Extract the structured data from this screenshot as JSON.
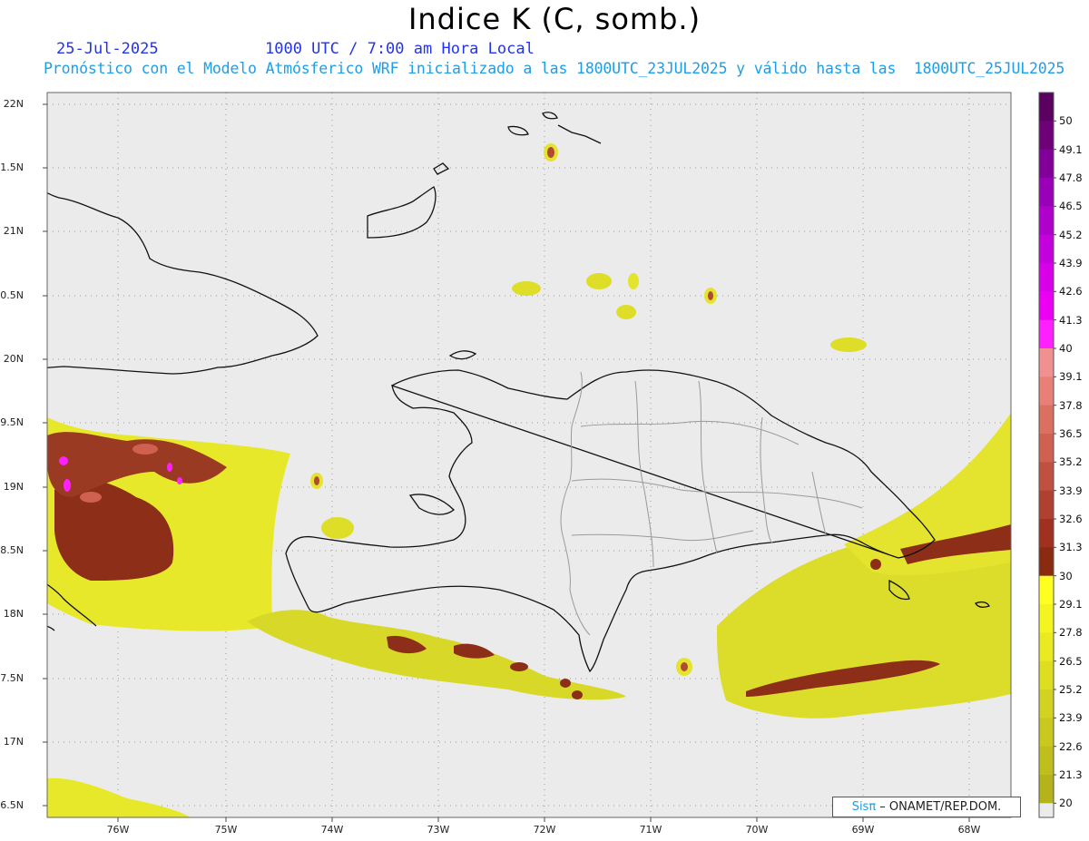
{
  "header": {
    "title": "Indice K (C, somb.)",
    "date": "25-Jul-2025",
    "time": "1000 UTC / 7:00 am Hora Local",
    "forecast": "Pronóstico con el Modelo Atmósferico WRF inicializado a las 1800UTC_23JUL2025 y válido hasta las  1800UTC_25JUL2025"
  },
  "map": {
    "lat_labels": [
      "22N",
      "1.5N",
      "21N",
      "0.5N",
      "20N",
      "9.5N",
      "19N",
      "8.5N",
      "18N",
      "7.5N",
      "17N",
      "6.5N"
    ],
    "lon_labels": [
      "76W",
      "75W",
      "74W",
      "73W",
      "72W",
      "71W",
      "70W",
      "69W",
      "68W"
    ],
    "land_color": "#ebebeb",
    "coast_color": "#111111",
    "border_color": "#9a9a9a"
  },
  "colorbar": {
    "labels": [
      "50",
      "49.1",
      "47.8",
      "46.5",
      "45.2",
      "43.9",
      "42.6",
      "41.3",
      "40",
      "39.1",
      "37.8",
      "36.5",
      "35.2",
      "33.9",
      "32.6",
      "31.3",
      "30",
      "29.1",
      "27.8",
      "26.5",
      "25.2",
      "23.9",
      "22.6",
      "21.3",
      "20"
    ],
    "colors": [
      "#5a0060",
      "#6e0078",
      "#82009a",
      "#9a00b8",
      "#b000cc",
      "#c400dc",
      "#d800e8",
      "#ec00f4",
      "#ff20ff",
      "#f09090",
      "#e88078",
      "#dc7060",
      "#d06050",
      "#c05040",
      "#b04030",
      "#a03020",
      "#8a2a10",
      "#ffff20",
      "#f4f420",
      "#eaea20",
      "#dede20",
      "#d2d220",
      "#c8c81e",
      "#bebe1c",
      "#b4b41a"
    ]
  },
  "credit": {
    "brand": "Sisπ",
    "text": " – ONAMET/REP.DOM."
  }
}
